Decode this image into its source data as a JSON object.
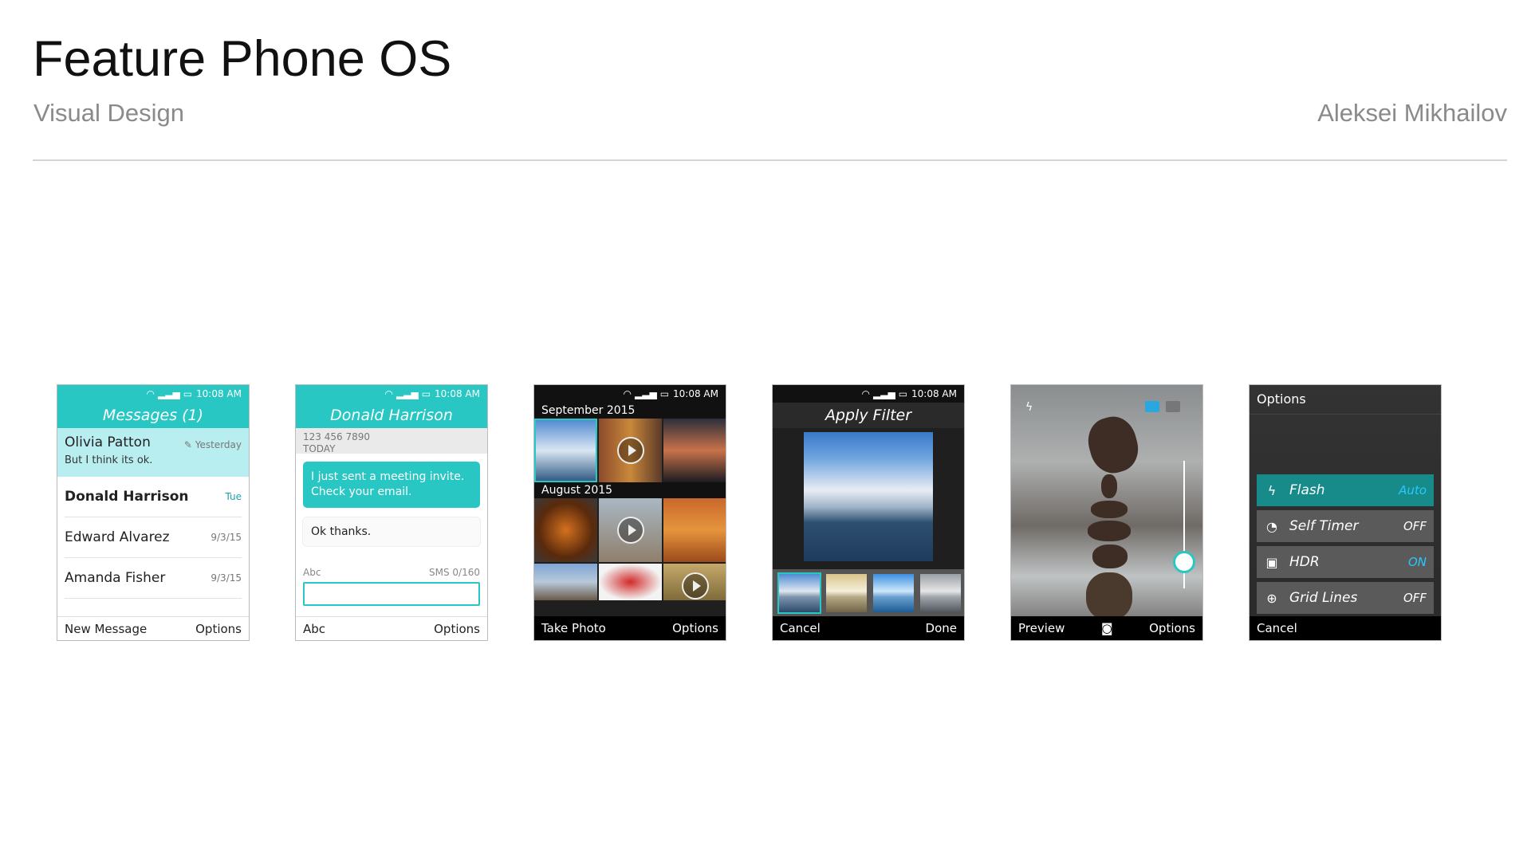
{
  "slide": {
    "title": "Feature Phone OS",
    "subtitle": "Visual Design",
    "author": "Aleksei Mikhailov"
  },
  "status_time": "10:08 AM",
  "messages": {
    "header": "Messages (1)",
    "items": [
      {
        "name": "Olivia Patton",
        "date": "Yesterday",
        "preview": "But I think its ok."
      },
      {
        "name": "Donald Harrison",
        "date": "Tue"
      },
      {
        "name": "Edward Alvarez",
        "date": "9/3/15"
      },
      {
        "name": "Amanda Fisher",
        "date": "9/3/15"
      }
    ],
    "softkey_left": "New Message",
    "softkey_right": "Options"
  },
  "conversation": {
    "header": "Donald Harrison",
    "number": "123 456 7890",
    "day": "TODAY",
    "outgoing": "I just sent a meeting invite. Check your email.",
    "incoming": "Ok thanks.",
    "input_mode": "Abc",
    "counter": "SMS  0/160",
    "softkey_left": "Abc",
    "softkey_right": "Options"
  },
  "gallery": {
    "section1": "September 2015",
    "section2": "August 2015",
    "softkey_left": "Take Photo",
    "softkey_right": "Options"
  },
  "filter": {
    "header": "Apply Filter",
    "softkey_left": "Cancel",
    "softkey_right": "Done"
  },
  "camera": {
    "softkey_left": "Preview",
    "softkey_right": "Options"
  },
  "options": {
    "title": "Options",
    "rows": [
      {
        "label": "Flash",
        "value": "Auto"
      },
      {
        "label": "Self Timer",
        "value": "OFF"
      },
      {
        "label": "HDR",
        "value": "ON"
      },
      {
        "label": "Grid Lines",
        "value": "OFF"
      }
    ],
    "softkey_left": "Cancel"
  },
  "colors": {
    "accent": "#29c7c3",
    "selected_row": "#b9eef1"
  }
}
